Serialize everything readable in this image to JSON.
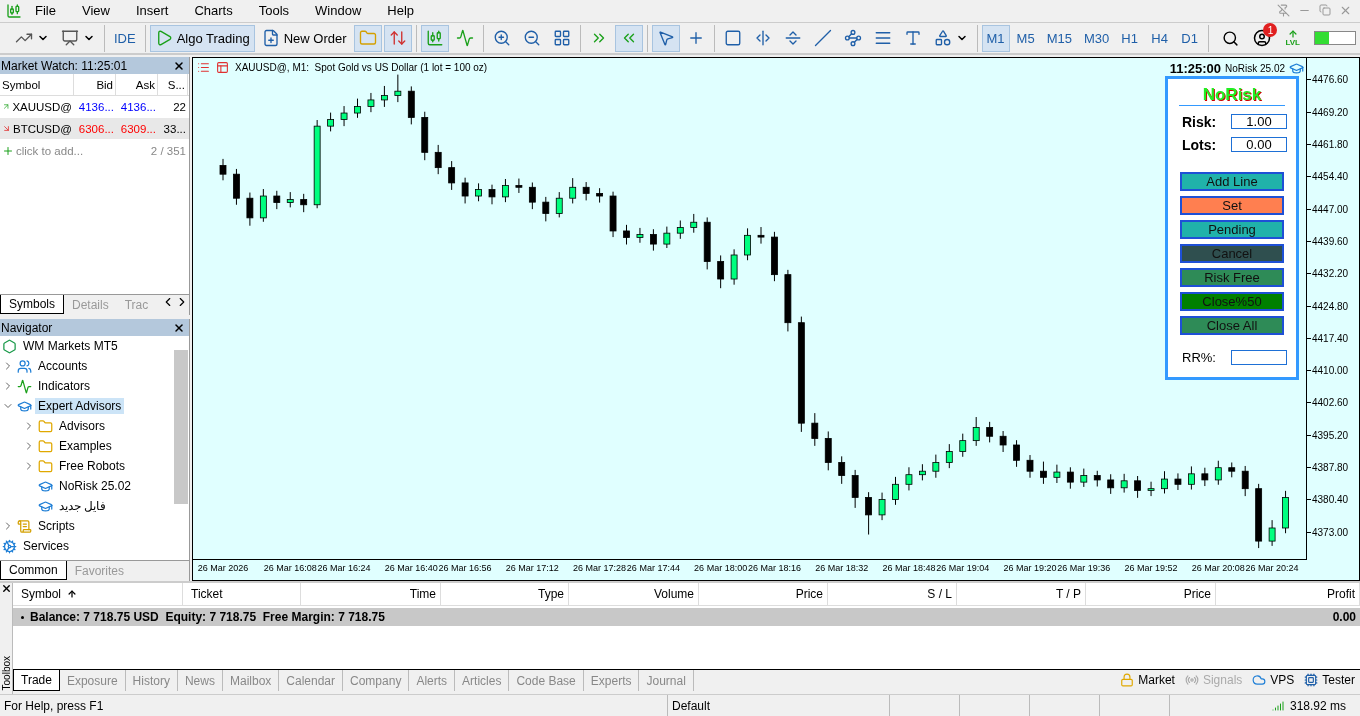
{
  "app_title_menu": [
    "File",
    "View",
    "Insert",
    "Charts",
    "Tools",
    "Window",
    "Help"
  ],
  "toolbar_groups": [
    [
      {
        "kind": "chart-type",
        "selected": false
      },
      {
        "kind": "templates",
        "selected": false
      }
    ],
    [
      {
        "kind": "text",
        "label": "IDE",
        "selected": false
      }
    ],
    [
      {
        "kind": "algo",
        "label": "Algo Trading",
        "selected": true
      },
      {
        "kind": "order",
        "label": "New Order",
        "selected": false
      },
      {
        "kind": "dom",
        "selected": true
      },
      {
        "kind": "one-click",
        "selected": true
      }
    ],
    [
      {
        "kind": "candles",
        "selected": true
      },
      {
        "kind": "indicators",
        "selected": false
      }
    ],
    [
      {
        "kind": "zoom-in",
        "selected": false
      },
      {
        "kind": "zoom-out",
        "selected": false
      },
      {
        "kind": "tile",
        "selected": false
      }
    ],
    [
      {
        "kind": "autoscroll",
        "selected": false
      },
      {
        "kind": "chart-shift",
        "selected": true
      }
    ],
    [
      {
        "kind": "cursor",
        "selected": true
      },
      {
        "kind": "crosshair",
        "selected": false
      }
    ],
    [
      {
        "kind": "rectangle",
        "selected": false
      },
      {
        "kind": "vline",
        "selected": false
      },
      {
        "kind": "hline",
        "selected": false
      },
      {
        "kind": "trendline",
        "selected": false
      },
      {
        "kind": "channel",
        "selected": false
      },
      {
        "kind": "fibo",
        "selected": false
      },
      {
        "kind": "label",
        "selected": false
      },
      {
        "kind": "shapes",
        "selected": false
      }
    ],
    [
      {
        "kind": "text",
        "label": "M1",
        "selected": true
      },
      {
        "kind": "text",
        "label": "M5",
        "selected": false
      },
      {
        "kind": "text",
        "label": "M15",
        "selected": false
      },
      {
        "kind": "text",
        "label": "M30",
        "selected": false
      },
      {
        "kind": "text",
        "label": "H1",
        "selected": false
      },
      {
        "kind": "text",
        "label": "H4",
        "selected": false
      },
      {
        "kind": "text",
        "label": "D1",
        "selected": false
      }
    ]
  ],
  "notification_count": "1",
  "lvl_label": "LVL",
  "meter": {
    "level": 0.35
  },
  "market_watch": {
    "title": "Market Watch: 11:25:01",
    "columns": [
      "Symbol",
      "Bid",
      "Ask",
      "S..."
    ],
    "rows": [
      {
        "rising": true,
        "selected": false,
        "cells": [
          "XAUUSD@",
          "4136...",
          "4136...",
          "22"
        ]
      },
      {
        "rising": false,
        "selected": true,
        "cells": [
          "BTCUSD@",
          "6306...",
          "6309...",
          "33..."
        ]
      }
    ],
    "add_label": "click to add...",
    "count": "2 / 351",
    "tabs": [
      {
        "label": "Symbols",
        "selected": true
      },
      {
        "label": "Details",
        "selected": false
      },
      {
        "label": "Trac",
        "selected": false
      }
    ]
  },
  "navigator": {
    "title": "Navigator",
    "items": [
      {
        "kind": "broker",
        "label": "WM Markets MT5",
        "selected": false,
        "children": [
          {
            "kind": "accounts",
            "label": "Accounts",
            "expanded": false,
            "selected": false
          },
          {
            "kind": "indicators",
            "label": "Indicators",
            "expanded": false,
            "selected": false
          },
          {
            "kind": "experts",
            "label": "Expert Advisors",
            "expanded": true,
            "selected": true,
            "children": [
              {
                "kind": "folder",
                "label": "Advisors",
                "expanded": false,
                "selected": false
              },
              {
                "kind": "folder",
                "label": "Examples",
                "expanded": false,
                "selected": false
              },
              {
                "kind": "folder",
                "label": "Free Robots",
                "expanded": false,
                "selected": false
              },
              {
                "kind": "expert",
                "label": "NoRisk 25.02",
                "selected": false
              },
              {
                "kind": "expert",
                "label": "فایل جدید",
                "selected": false
              }
            ]
          },
          {
            "kind": "scripts",
            "label": "Scripts",
            "expanded": false,
            "selected": false
          },
          {
            "kind": "services",
            "label": "Services",
            "selected": false
          }
        ]
      }
    ],
    "tabs": [
      {
        "label": "Common",
        "selected": true
      },
      {
        "label": "Favorites",
        "selected": false
      }
    ]
  },
  "chart": {
    "title": "XAUUSD@, M1:  Spot Gold vs US Dollar (1 lot = 100 oz)",
    "clock": "11:25:00",
    "ea_name": "NoRisk 25.02",
    "chart_data": {
      "type": "candlestick",
      "ylim": [
        4366.9,
        4481.6
      ],
      "categories": [
        "26 Mar 2026",
        null,
        null,
        null,
        null,
        "26 Mar 16:08",
        null,
        null,
        null,
        "26 Mar 16:24",
        null,
        null,
        null,
        null,
        "26 Mar 16:40",
        null,
        null,
        null,
        "26 Mar 16:56",
        null,
        null,
        null,
        null,
        "26 Mar 17:12",
        null,
        null,
        null,
        null,
        "26 Mar 17:28",
        null,
        null,
        null,
        "26 Mar 17:44",
        null,
        null,
        null,
        null,
        "26 Mar 18:00",
        null,
        null,
        null,
        "26 Mar 18:16",
        null,
        null,
        null,
        null,
        "26 Mar 18:32",
        null,
        null,
        null,
        null,
        "26 Mar 18:48",
        null,
        null,
        null,
        "26 Mar 19:04",
        null,
        null,
        null,
        null,
        "26 Mar 19:20",
        null,
        null,
        null,
        "26 Mar 19:36",
        null,
        null,
        null,
        null,
        "26 Mar 19:52",
        null,
        null,
        null,
        null,
        "26 Mar 20:08",
        null,
        null,
        null,
        "26 Mar 20:24",
        null
      ],
      "ohlc": [
        [
          4457.0,
          4458.5,
          4453.6,
          4455.0
        ],
        [
          4455.0,
          4456.2,
          4448.0,
          4449.5
        ],
        [
          4449.5,
          4450.8,
          4443.2,
          4445.0
        ],
        [
          4445.0,
          4451.6,
          4444.1,
          4450.0
        ],
        [
          4450.0,
          4451.2,
          4447.0,
          4448.5
        ],
        [
          4448.5,
          4450.9,
          4447.4,
          4449.2
        ],
        [
          4449.2,
          4450.5,
          4446.3,
          4448.0
        ],
        [
          4448.0,
          4467.4,
          4447.2,
          4466.0
        ],
        [
          4466.0,
          4469.1,
          4464.8,
          4467.5
        ],
        [
          4467.5,
          4470.6,
          4466.0,
          4469.0
        ],
        [
          4469.0,
          4472.3,
          4467.9,
          4470.5
        ],
        [
          4470.5,
          4473.6,
          4469.2,
          4472.0
        ],
        [
          4472.0,
          4475.2,
          4470.4,
          4473.0
        ],
        [
          4473.0,
          4477.8,
          4471.5,
          4474.0
        ],
        [
          4474.0,
          4475.1,
          4466.4,
          4468.0
        ],
        [
          4468.0,
          4469.3,
          4458.2,
          4460.0
        ],
        [
          4460.0,
          4461.7,
          4455.0,
          4456.5
        ],
        [
          4456.5,
          4458.0,
          4451.4,
          4453.0
        ],
        [
          4453.0,
          4454.2,
          4448.3,
          4450.0
        ],
        [
          4450.0,
          4452.9,
          4448.8,
          4451.5
        ],
        [
          4451.5,
          4452.6,
          4448.1,
          4449.8
        ],
        [
          4449.8,
          4453.9,
          4448.6,
          4452.4
        ],
        [
          4452.4,
          4454.0,
          4450.7,
          4452.0
        ],
        [
          4452.0,
          4453.1,
          4447.0,
          4448.6
        ],
        [
          4448.6,
          4449.8,
          4444.2,
          4446.0
        ],
        [
          4446.0,
          4450.9,
          4445.1,
          4449.5
        ],
        [
          4449.5,
          4454.1,
          4448.3,
          4452.0
        ],
        [
          4452.0,
          4453.2,
          4449.0,
          4450.6
        ],
        [
          4450.6,
          4451.8,
          4448.5,
          4450.0
        ],
        [
          4450.0,
          4451.0,
          4440.6,
          4442.0
        ],
        [
          4442.0,
          4443.4,
          4438.9,
          4440.5
        ],
        [
          4440.5,
          4442.7,
          4439.3,
          4441.2
        ],
        [
          4441.2,
          4442.4,
          4437.5,
          4439.0
        ],
        [
          4439.0,
          4443.0,
          4438.1,
          4441.5
        ],
        [
          4441.5,
          4444.4,
          4440.2,
          4442.8
        ],
        [
          4442.8,
          4445.9,
          4441.6,
          4444.0
        ],
        [
          4444.0,
          4445.1,
          4433.2,
          4435.0
        ],
        [
          4435.0,
          4436.4,
          4428.9,
          4431.0
        ],
        [
          4431.0,
          4437.8,
          4429.7,
          4436.5
        ],
        [
          4436.5,
          4442.6,
          4435.3,
          4441.0
        ],
        [
          4441.0,
          4442.9,
          4439.1,
          4440.6
        ],
        [
          4440.6,
          4441.8,
          4430.5,
          4432.0
        ],
        [
          4432.0,
          4433.1,
          4419.0,
          4421.0
        ],
        [
          4421.0,
          4422.4,
          4396.0,
          4398.0
        ],
        [
          4398.0,
          4400.3,
          4392.8,
          4394.5
        ],
        [
          4394.5,
          4396.1,
          4387.2,
          4389.0
        ],
        [
          4389.0,
          4390.4,
          4384.1,
          4386.0
        ],
        [
          4386.0,
          4387.3,
          4378.6,
          4381.0
        ],
        [
          4381.0,
          4382.2,
          4372.5,
          4377.0
        ],
        [
          4377.0,
          4382.1,
          4375.8,
          4380.5
        ],
        [
          4380.5,
          4385.7,
          4379.3,
          4384.0
        ],
        [
          4384.0,
          4387.9,
          4382.6,
          4386.2
        ],
        [
          4386.2,
          4388.6,
          4384.9,
          4387.0
        ],
        [
          4387.0,
          4390.8,
          4385.5,
          4389.0
        ],
        [
          4389.0,
          4393.2,
          4387.7,
          4391.5
        ],
        [
          4391.5,
          4395.6,
          4390.3,
          4394.0
        ],
        [
          4394.0,
          4399.4,
          4392.8,
          4397.0
        ],
        [
          4397.0,
          4398.3,
          4393.6,
          4395.0
        ],
        [
          4395.0,
          4396.2,
          4391.4,
          4393.0
        ],
        [
          4393.0,
          4394.1,
          4388.0,
          4389.5
        ],
        [
          4389.5,
          4390.7,
          4385.5,
          4387.0
        ],
        [
          4387.0,
          4389.2,
          4384.1,
          4385.6
        ],
        [
          4385.6,
          4388.5,
          4384.3,
          4386.8
        ],
        [
          4386.8,
          4387.9,
          4383.0,
          4384.5
        ],
        [
          4384.5,
          4387.6,
          4383.4,
          4386.0
        ],
        [
          4386.0,
          4387.1,
          4383.5,
          4385.0
        ],
        [
          4385.0,
          4386.3,
          4381.8,
          4383.2
        ],
        [
          4383.2,
          4386.4,
          4382.1,
          4384.8
        ],
        [
          4384.8,
          4385.9,
          4380.9,
          4382.6
        ],
        [
          4382.6,
          4384.6,
          4381.3,
          4383.0
        ],
        [
          4383.0,
          4387.0,
          4381.9,
          4385.2
        ],
        [
          4385.2,
          4386.5,
          4382.7,
          4384.0
        ],
        [
          4384.0,
          4388.1,
          4382.8,
          4386.4
        ],
        [
          4386.4,
          4387.8,
          4383.6,
          4385.0
        ],
        [
          4385.0,
          4389.4,
          4383.9,
          4387.8
        ],
        [
          4387.8,
          4389.0,
          4385.6,
          4387.0
        ],
        [
          4387.0,
          4388.2,
          4381.3,
          4383.0
        ],
        [
          4383.0,
          4384.1,
          4369.4,
          4371.0
        ],
        [
          4371.0,
          4375.8,
          4369.9,
          4374.0
        ],
        [
          4374.0,
          4382.5,
          4372.8,
          4381.0
        ]
      ],
      "yticks": [
        {
          "value": 4476.6,
          "label": "4476.60"
        },
        {
          "value": 4469.2,
          "label": "4469.20"
        },
        {
          "value": 4461.8,
          "label": "4461.80"
        },
        {
          "value": 4454.4,
          "label": "4454.40"
        },
        {
          "value": 4447.0,
          "label": "4447.00"
        },
        {
          "value": 4439.6,
          "label": "4439.60"
        },
        {
          "value": 4432.2,
          "label": "4432.20"
        },
        {
          "value": 4424.8,
          "label": "4424.80"
        },
        {
          "value": 4417.4,
          "label": "4417.40"
        },
        {
          "value": 4410.0,
          "label": "4410.00"
        },
        {
          "value": 4402.6,
          "label": "4402.60"
        },
        {
          "value": 4395.2,
          "label": "4395.20"
        },
        {
          "value": 4387.8,
          "label": "4387.80"
        },
        {
          "value": 4380.4,
          "label": "4380.40"
        },
        {
          "value": 4373.0,
          "label": "4373.00"
        }
      ],
      "xlabel": null
    }
  },
  "panel": {
    "title": "NoRisk",
    "fields": [
      {
        "label": "Risk:",
        "value": "1.00"
      },
      {
        "label": "Lots:",
        "value": "0.00"
      }
    ],
    "buttons": [
      {
        "label": "Add Line",
        "color": "#20b2aa"
      },
      {
        "label": "Set",
        "color": "#ff7f50"
      },
      {
        "label": "Pending",
        "color": "#20b2aa"
      },
      {
        "label": "Cancel",
        "color": "#2f4f4f"
      },
      {
        "label": "Risk Free",
        "color": "#2e8b57"
      },
      {
        "label": "Close%50",
        "color": "#008000"
      },
      {
        "label": "Close All",
        "color": "#2e8b57"
      }
    ],
    "rr_label": "RR%:"
  },
  "toolbox": {
    "side_label": "Toolbox",
    "columns": [
      {
        "label": "Symbol",
        "sorted": true
      },
      {
        "label": "Ticket",
        "sorted": false
      },
      {
        "label": "Time",
        "sorted": false
      },
      {
        "label": "Type",
        "sorted": false
      },
      {
        "label": "Volume",
        "sorted": false
      },
      {
        "label": "Price",
        "sorted": false
      },
      {
        "label": "S / L",
        "sorted": false
      },
      {
        "label": "T / P",
        "sorted": false
      },
      {
        "label": "Price",
        "sorted": false
      },
      {
        "label": "Profit",
        "sorted": false
      }
    ],
    "balance": "Balance: 7 718.75 USD  Equity: 7 718.75  Free Margin: 7 718.75",
    "profit": "0.00",
    "tabs": [
      {
        "label": "Trade",
        "selected": true
      },
      {
        "label": "Exposure",
        "selected": false
      },
      {
        "label": "History",
        "selected": false
      },
      {
        "label": "News",
        "selected": false
      },
      {
        "label": "Mailbox",
        "selected": false
      },
      {
        "label": "Calendar",
        "selected": false
      },
      {
        "label": "Company",
        "selected": false
      },
      {
        "label": "Alerts",
        "selected": false
      },
      {
        "label": "Articles",
        "selected": false
      },
      {
        "label": "Code Base",
        "selected": false
      },
      {
        "label": "Experts",
        "selected": false
      },
      {
        "label": "Journal",
        "selected": false
      }
    ],
    "links": [
      {
        "kind": "market",
        "label": "Market",
        "disabled": false
      },
      {
        "kind": "signals",
        "label": "Signals",
        "disabled": true
      },
      {
        "kind": "vps",
        "label": "VPS",
        "disabled": false
      },
      {
        "kind": "tester",
        "label": "Tester",
        "disabled": false
      }
    ]
  },
  "status_bar": {
    "help": "For Help, press F1",
    "profile": "Default",
    "ping": "318.92 ms"
  }
}
